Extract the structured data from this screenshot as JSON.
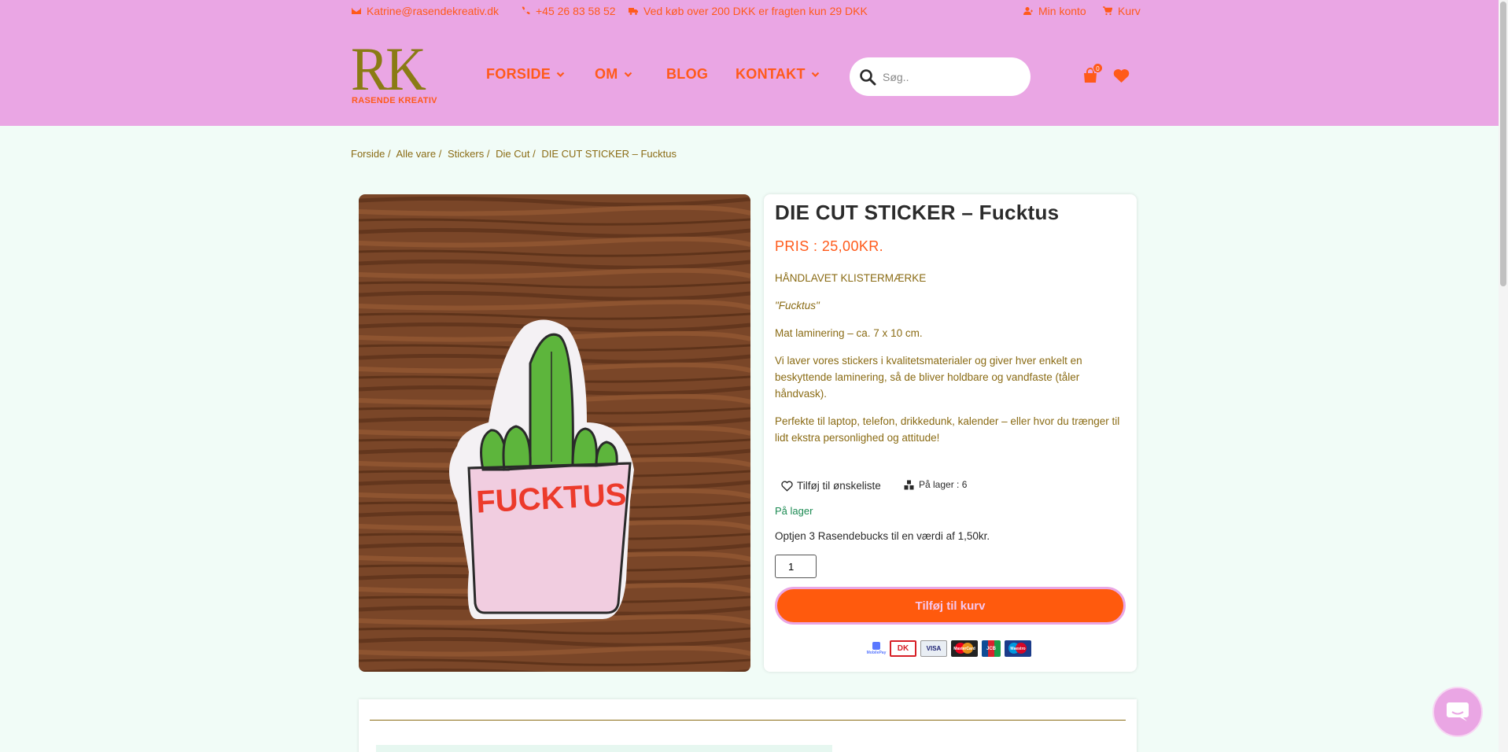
{
  "topbar": {
    "email": "Katrine@rasendekreativ.dk",
    "phone": "+45 26 83 58 52",
    "shipping": "Ved køb over 200 DKK er fragten kun 29 DKK",
    "account": "Min konto",
    "cart": "Kurv"
  },
  "logo": {
    "letters": "RK",
    "name": "RASENDE KREATIV"
  },
  "nav": {
    "home": "FORSIDE",
    "about": "OM",
    "blog": "BLOG",
    "contact": "KONTAKT"
  },
  "search": {
    "placeholder": "Søg.."
  },
  "header_cart": {
    "count": "0"
  },
  "breadcrumb": {
    "home": "Forside",
    "sep1": "/",
    "all": "Alle vare",
    "sep2": "/",
    "stickers": "Stickers",
    "sep3": "/",
    "diecut": "Die Cut",
    "sep4": "/",
    "current": "DIE CUT STICKER – Fucktus"
  },
  "product": {
    "title": "DIE CUT STICKER – Fucktus",
    "price": "PRIS : 25,00KR.",
    "desc_heading": "HÅNDLAVET KLISTERMÆRKE",
    "desc_name": "\"Fucktus\"",
    "desc_size": "Mat laminering – ca. 7 x 10 cm.",
    "desc_quality": "Vi laver vores stickers i kvalitetsmaterialer og giver hver enkelt en beskyttende laminering, så de bliver holdbare og vandfaste (tåler håndvask).",
    "desc_use": "Perfekte til laptop, telefon, drikkedunk, kalender – eller hvor du trænger til lidt ekstra personlighed og attitude!",
    "wishlist": "Tilføj til ønskeliste",
    "stock_label": "På lager : 6",
    "stock_status": "På lager",
    "earn": "Optjen 3 Rasendebucks til en værdi af 1,50kr.",
    "quantity": "1",
    "add_to_cart": "Tilføj til kurv",
    "sticker_text": "FUCKTUS"
  },
  "payments": [
    "MobilePay",
    "DK",
    "VISA",
    "MasterCard",
    "JCB",
    "Maestro"
  ],
  "colors": {
    "header_bg": "#eaa6e4",
    "accent": "#ff5a1a",
    "page_bg": "#f1fcf7",
    "olive": "#8a6b14",
    "green": "#1b8a52"
  }
}
